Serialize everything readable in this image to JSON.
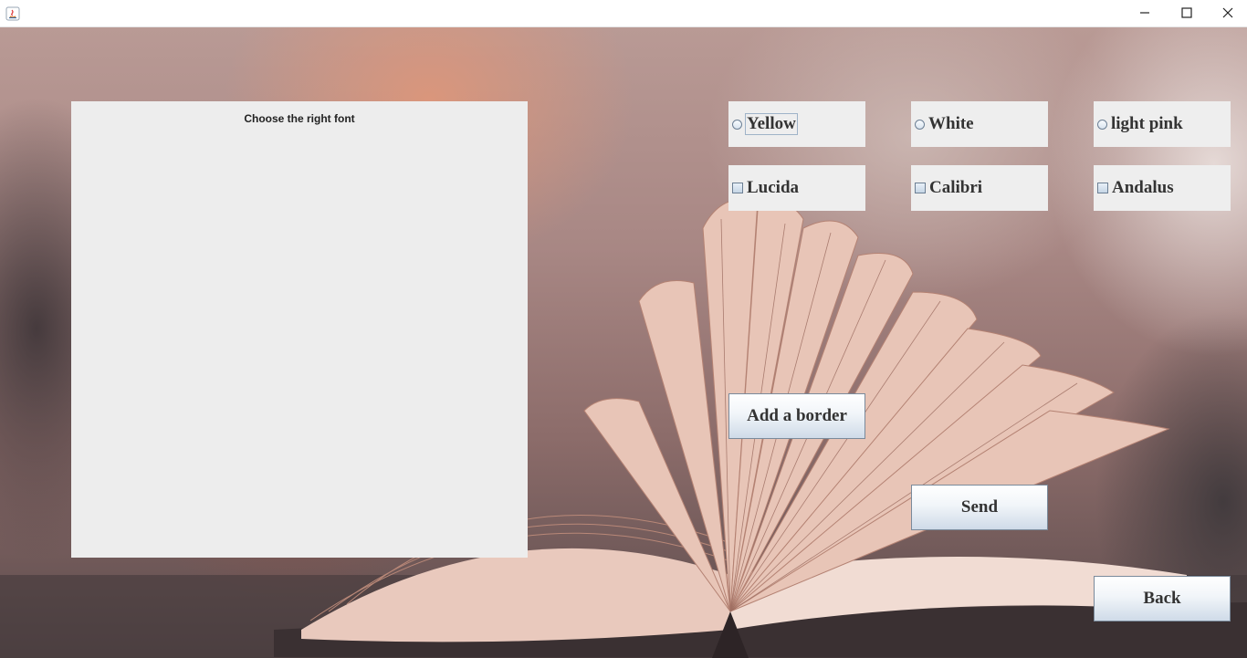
{
  "window": {
    "controls": {
      "minimize_icon": "minimize-icon",
      "maximize_icon": "maximize-icon",
      "close_icon": "close-icon"
    }
  },
  "panel": {
    "title": "Choose the right font"
  },
  "colors": {
    "label": "Yellow",
    "options": [
      "Yellow",
      "White",
      "light pink"
    ]
  },
  "color_options": [
    {
      "label": "Yellow",
      "selected": false,
      "focused": true
    },
    {
      "label": "White",
      "selected": false,
      "focused": false
    },
    {
      "label": "light pink",
      "selected": false,
      "focused": false
    }
  ],
  "font_options": [
    {
      "label": "Lucida",
      "checked": false
    },
    {
      "label": "Calibri",
      "checked": false
    },
    {
      "label": "Andalus",
      "checked": false
    }
  ],
  "buttons": {
    "add_border": "Add a border",
    "send": "Send",
    "back": "Back"
  },
  "theme": {
    "panel_bg": "#ededed",
    "option_bg": "#eeeeee",
    "text": "#333333",
    "button_gradient_bottom": "#cfdbe8"
  }
}
